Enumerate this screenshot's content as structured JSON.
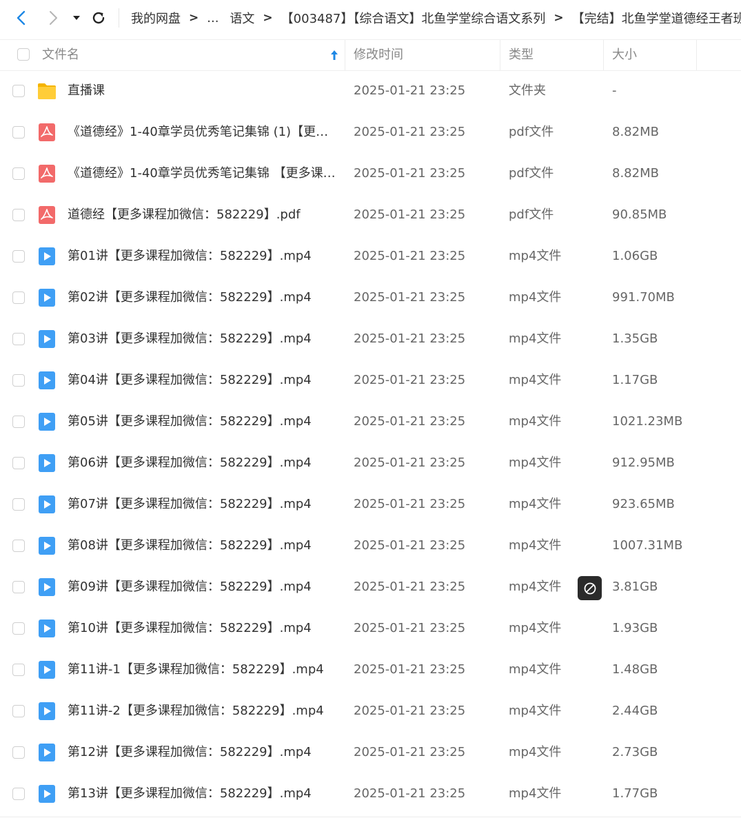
{
  "toolbar": {
    "back_icon": "chevron-left-icon",
    "forward_icon": "chevron-right-icon",
    "dropdown_icon": "caret-down-icon",
    "refresh_icon": "refresh-icon",
    "accent": "#1e88e5"
  },
  "breadcrumb": {
    "items": [
      "我的网盘",
      "...",
      "语文",
      "【003487】【综合语文】北鱼学堂综合语文系列",
      "【完结】北鱼学堂道德经王者班"
    ]
  },
  "header": {
    "name": "文件名",
    "modified": "修改时间",
    "type": "类型",
    "size": "大小",
    "sort_icon": "sort-ascending-arrow-icon"
  },
  "rows": [
    {
      "icon": "folder",
      "name": "直播课",
      "date": "2025-01-21 23:25",
      "type": "文件夹",
      "size": "-"
    },
    {
      "icon": "pdf",
      "name": "《道德经》1-40章学员优秀笔记集锦 (1)【更多…",
      "date": "2025-01-21 23:25",
      "type": "pdf文件",
      "size": "8.82MB"
    },
    {
      "icon": "pdf",
      "name": "《道德经》1-40章学员优秀笔记集锦 【更多课…",
      "date": "2025-01-21 23:25",
      "type": "pdf文件",
      "size": "8.82MB"
    },
    {
      "icon": "pdf",
      "name": "道德经【更多课程加微信：582229】.pdf",
      "date": "2025-01-21 23:25",
      "type": "pdf文件",
      "size": "90.85MB"
    },
    {
      "icon": "video",
      "name": "第01讲【更多课程加微信：582229】.mp4",
      "date": "2025-01-21 23:25",
      "type": "mp4文件",
      "size": "1.06GB"
    },
    {
      "icon": "video",
      "name": "第02讲【更多课程加微信：582229】.mp4",
      "date": "2025-01-21 23:25",
      "type": "mp4文件",
      "size": "991.70MB"
    },
    {
      "icon": "video",
      "name": "第03讲【更多课程加微信：582229】.mp4",
      "date": "2025-01-21 23:25",
      "type": "mp4文件",
      "size": "1.35GB"
    },
    {
      "icon": "video",
      "name": "第04讲【更多课程加微信：582229】.mp4",
      "date": "2025-01-21 23:25",
      "type": "mp4文件",
      "size": "1.17GB"
    },
    {
      "icon": "video",
      "name": "第05讲【更多课程加微信：582229】.mp4",
      "date": "2025-01-21 23:25",
      "type": "mp4文件",
      "size": "1021.23MB"
    },
    {
      "icon": "video",
      "name": "第06讲【更多课程加微信：582229】.mp4",
      "date": "2025-01-21 23:25",
      "type": "mp4文件",
      "size": "912.95MB"
    },
    {
      "icon": "video",
      "name": "第07讲【更多课程加微信：582229】.mp4",
      "date": "2025-01-21 23:25",
      "type": "mp4文件",
      "size": "923.65MB"
    },
    {
      "icon": "video",
      "name": "第08讲【更多课程加微信：582229】.mp4",
      "date": "2025-01-21 23:25",
      "type": "mp4文件",
      "size": "1007.31MB"
    },
    {
      "icon": "video",
      "name": "第09讲【更多课程加微信：582229】.mp4",
      "date": "2025-01-21 23:25",
      "type": "mp4文件",
      "size": "3.81GB"
    },
    {
      "icon": "video",
      "name": "第10讲【更多课程加微信：582229】.mp4",
      "date": "2025-01-21 23:25",
      "type": "mp4文件",
      "size": "1.93GB"
    },
    {
      "icon": "video",
      "name": "第11讲-1【更多课程加微信：582229】.mp4",
      "date": "2025-01-21 23:25",
      "type": "mp4文件",
      "size": "1.48GB"
    },
    {
      "icon": "video",
      "name": "第11讲-2【更多课程加微信：582229】.mp4",
      "date": "2025-01-21 23:25",
      "type": "mp4文件",
      "size": "2.44GB"
    },
    {
      "icon": "video",
      "name": "第12讲【更多课程加微信：582229】.mp4",
      "date": "2025-01-21 23:25",
      "type": "mp4文件",
      "size": "2.73GB"
    },
    {
      "icon": "video",
      "name": "第13讲【更多课程加微信：582229】.mp4",
      "date": "2025-01-21 23:25",
      "type": "mp4文件",
      "size": "1.77GB"
    }
  ],
  "overlay": {
    "icon": "block-icon"
  },
  "colors": {
    "folder": "#ffc107",
    "pdf": "#f26a6a",
    "video": "#3f9ff5"
  }
}
